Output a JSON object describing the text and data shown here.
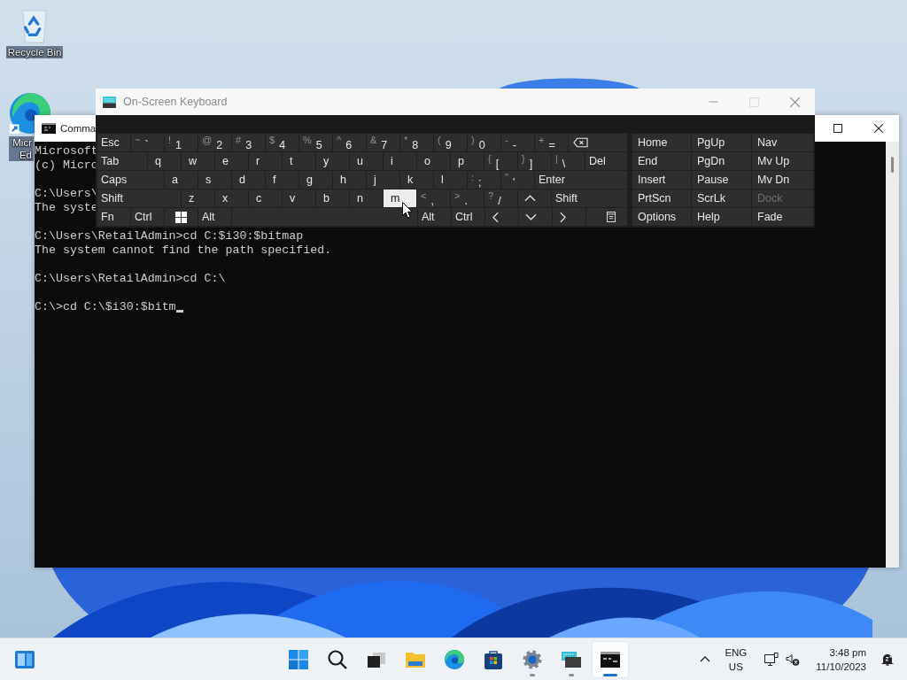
{
  "desktop": {
    "icons": [
      {
        "kind": "recycle-bin",
        "label_lines": [
          "Recycle Bin"
        ]
      },
      {
        "kind": "browser",
        "label_lines": [
          "Micr",
          "Ed"
        ]
      }
    ]
  },
  "command_prompt": {
    "title": "Comma",
    "blocks": [
      [
        "Microsoft",
        "(c) Micro"
      ],
      [
        "C:\\Users\\",
        "The syste"
      ],
      [
        "C:\\Users\\RetailAdmin>cd C:$i30:$bitmap",
        "The system cannot find the path specified."
      ],
      [
        "C:\\Users\\RetailAdmin>cd C:\\"
      ]
    ],
    "prompt": "C:\\>cd C:\\$i30:$bitm"
  },
  "on_screen_keyboard": {
    "title": "On-Screen Keyboard",
    "rows": [
      {
        "keys": [
          {
            "kind": "label",
            "label": "Esc",
            "highlighted": false
          },
          {
            "kind": "dual",
            "shift": "~",
            "main": "`",
            "highlighted": false
          },
          {
            "kind": "dual",
            "shift": "!",
            "main": "1",
            "highlighted": false
          },
          {
            "kind": "dual",
            "shift": "@",
            "main": "2",
            "highlighted": false
          },
          {
            "kind": "dual",
            "shift": "#",
            "main": "3",
            "highlighted": false
          },
          {
            "kind": "dual",
            "shift": "$",
            "main": "4",
            "highlighted": false
          },
          {
            "kind": "dual",
            "shift": "%",
            "main": "5",
            "highlighted": false
          },
          {
            "kind": "dual",
            "shift": "^",
            "main": "6",
            "highlighted": false
          },
          {
            "kind": "dual",
            "shift": "&",
            "main": "7",
            "highlighted": false
          },
          {
            "kind": "dual",
            "shift": "*",
            "main": "8",
            "highlighted": false
          },
          {
            "kind": "dual",
            "shift": "(",
            "main": "9",
            "highlighted": false
          },
          {
            "kind": "dual",
            "shift": ")",
            "main": "0",
            "highlighted": false
          },
          {
            "kind": "dual",
            "shift": "-",
            "main": "-",
            "highlighted": false
          },
          {
            "kind": "dual",
            "shift": "+",
            "main": "=",
            "highlighted": false
          },
          {
            "kind": "backspace",
            "highlighted": false
          }
        ]
      },
      {
        "keys": [
          {
            "kind": "label",
            "label": "Tab",
            "highlighted": false
          },
          {
            "kind": "char",
            "label": "q",
            "highlighted": false
          },
          {
            "kind": "char",
            "label": "w",
            "highlighted": false
          },
          {
            "kind": "char",
            "label": "e",
            "highlighted": false
          },
          {
            "kind": "char",
            "label": "r",
            "highlighted": false
          },
          {
            "kind": "char",
            "label": "t",
            "highlighted": false
          },
          {
            "kind": "char",
            "label": "y",
            "highlighted": false
          },
          {
            "kind": "char",
            "label": "u",
            "highlighted": false
          },
          {
            "kind": "char",
            "label": "i",
            "highlighted": false
          },
          {
            "kind": "char",
            "label": "o",
            "highlighted": false
          },
          {
            "kind": "char",
            "label": "p",
            "highlighted": false
          },
          {
            "kind": "dual",
            "shift": "{",
            "main": "[",
            "highlighted": false
          },
          {
            "kind": "dual",
            "shift": "}",
            "main": "]",
            "highlighted": false
          },
          {
            "kind": "dual",
            "shift": "|",
            "main": "\\",
            "highlighted": false
          },
          {
            "kind": "label",
            "label": "Del",
            "highlighted": false
          }
        ]
      },
      {
        "keys": [
          {
            "kind": "label",
            "label": "Caps",
            "highlighted": false
          },
          {
            "kind": "char",
            "label": "a",
            "highlighted": false
          },
          {
            "kind": "char",
            "label": "s",
            "highlighted": false
          },
          {
            "kind": "char",
            "label": "d",
            "highlighted": false
          },
          {
            "kind": "char",
            "label": "f",
            "highlighted": false
          },
          {
            "kind": "char",
            "label": "g",
            "highlighted": false
          },
          {
            "kind": "char",
            "label": "h",
            "highlighted": false
          },
          {
            "kind": "char",
            "label": "j",
            "highlighted": false
          },
          {
            "kind": "char",
            "label": "k",
            "highlighted": false
          },
          {
            "kind": "char",
            "label": "l",
            "highlighted": false
          },
          {
            "kind": "dual",
            "shift": ":",
            "main": ";",
            "highlighted": false
          },
          {
            "kind": "dual",
            "shift": "\"",
            "main": "'",
            "highlighted": false
          },
          {
            "kind": "label",
            "label": "Enter",
            "highlighted": false
          }
        ]
      },
      {
        "keys": [
          {
            "kind": "label",
            "label": "Shift",
            "highlighted": false
          },
          {
            "kind": "char",
            "label": "z",
            "highlighted": false
          },
          {
            "kind": "char",
            "label": "x",
            "highlighted": false
          },
          {
            "kind": "char",
            "label": "c",
            "highlighted": false
          },
          {
            "kind": "char",
            "label": "v",
            "highlighted": false
          },
          {
            "kind": "char",
            "label": "b",
            "highlighted": false
          },
          {
            "kind": "char",
            "label": "n",
            "highlighted": false
          },
          {
            "kind": "char",
            "label": "m",
            "highlighted": true
          },
          {
            "kind": "dual",
            "shift": "<",
            "main": ",",
            "highlighted": false
          },
          {
            "kind": "dual",
            "shift": ">",
            "main": ".",
            "highlighted": false
          },
          {
            "kind": "dual",
            "shift": "?",
            "main": "/",
            "highlighted": false
          },
          {
            "kind": "up",
            "highlighted": false
          },
          {
            "kind": "label",
            "label": "Shift",
            "highlighted": false
          }
        ]
      },
      {
        "keys": [
          {
            "kind": "label",
            "label": "Fn",
            "highlighted": false
          },
          {
            "kind": "label",
            "label": "Ctrl",
            "highlighted": false
          },
          {
            "kind": "windows",
            "highlighted": false
          },
          {
            "kind": "label",
            "label": "Alt",
            "highlighted": false
          },
          {
            "kind": "space",
            "highlighted": false
          },
          {
            "kind": "label",
            "label": "Alt",
            "highlighted": false
          },
          {
            "kind": "label",
            "label": "Ctrl",
            "highlighted": false
          },
          {
            "kind": "left",
            "highlighted": false
          },
          {
            "kind": "down",
            "highlighted": false
          },
          {
            "kind": "right",
            "highlighted": false
          },
          {
            "kind": "menu",
            "highlighted": false
          }
        ]
      }
    ],
    "side_keys": [
      {
        "label": "Home",
        "disabled": false
      },
      {
        "label": "PgUp",
        "disabled": false
      },
      {
        "label": "Nav",
        "disabled": false
      },
      {
        "label": "End",
        "disabled": false
      },
      {
        "label": "PgDn",
        "disabled": false
      },
      {
        "label": "Mv Up",
        "disabled": false
      },
      {
        "label": "Insert",
        "disabled": false
      },
      {
        "label": "Pause",
        "disabled": false
      },
      {
        "label": "Mv Dn",
        "disabled": false
      },
      {
        "label": "PrtScn",
        "disabled": false
      },
      {
        "label": "ScrLk",
        "disabled": false
      },
      {
        "label": "Dock",
        "disabled": true
      },
      {
        "label": "Options",
        "disabled": false
      },
      {
        "label": "Help",
        "disabled": false
      },
      {
        "label": "Fade",
        "disabled": false
      }
    ]
  },
  "taskbar": {
    "items": [
      {
        "kind": "start",
        "running": false,
        "selected": false
      },
      {
        "kind": "search",
        "running": false,
        "selected": false
      },
      {
        "kind": "task-view",
        "running": false,
        "selected": false
      },
      {
        "kind": "explorer",
        "running": false,
        "selected": false
      },
      {
        "kind": "browser",
        "running": false,
        "selected": false
      },
      {
        "kind": "store",
        "running": false,
        "selected": false
      },
      {
        "kind": "settings",
        "running": true,
        "selected": false
      },
      {
        "kind": "keyboard",
        "running": true,
        "selected": false
      },
      {
        "kind": "terminal",
        "running": true,
        "selected": true
      }
    ],
    "language": {
      "primary": "ENG",
      "secondary": "US"
    },
    "clock": {
      "time": "3:48 pm",
      "date": "11/10/2023"
    }
  }
}
